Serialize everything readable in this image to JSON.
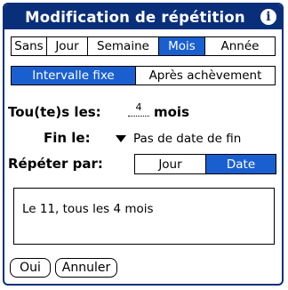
{
  "dialog": {
    "title": "Modification de répétition",
    "info_icon_glyph": "i"
  },
  "repeat_type": {
    "options": [
      "Sans",
      "Jour",
      "Semaine",
      "Mois",
      "Année"
    ],
    "selected": "Mois"
  },
  "interval_mode": {
    "options": [
      "Intervalle fixe",
      "Après achèvement"
    ],
    "selected": "Intervalle fixe"
  },
  "every": {
    "label": "Tou(te)s les:",
    "value": "4",
    "unit": "mois"
  },
  "end": {
    "label": "Fin le:",
    "value": "Pas de date de fin"
  },
  "repeat_by": {
    "label": "Répéter par:",
    "options": [
      "Jour",
      "Date"
    ],
    "selected": "Date"
  },
  "summary": "Le 11, tous les 4 mois",
  "buttons": {
    "ok": "Oui",
    "cancel": "Annuler"
  },
  "colors": {
    "title_bar": "#0a2f7a",
    "selected": "#1a5fd0"
  }
}
